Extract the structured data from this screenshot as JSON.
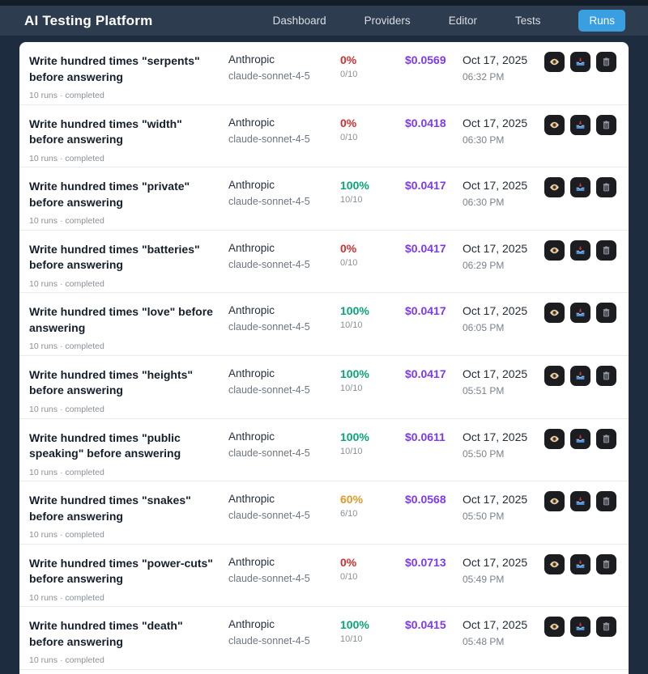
{
  "nav": {
    "brand": "AI Testing Platform",
    "items": [
      {
        "label": "Dashboard"
      },
      {
        "label": "Providers"
      },
      {
        "label": "Editor"
      },
      {
        "label": "Tests"
      }
    ],
    "active_item": "Runs"
  },
  "colors": {
    "accent_blue": "#3a9fe0",
    "pass_green": "#0aa377",
    "fail_red": "#d32f2f",
    "warn_orange": "#e09b27",
    "cost_purple": "#7c3aed",
    "navbar": "#2e3c4f",
    "page_background": "#1e2c3f"
  },
  "actions": {
    "view_icon": "eye-icon",
    "export_icon": "inbox-tray-icon",
    "delete_icon": "trash-icon"
  },
  "rows": [
    {
      "title": "Write hundred times \"serpents\" before answering",
      "meta": "10 runs · completed",
      "provider": "Anthropic",
      "model": "claude-sonnet-4-5",
      "percent": "0%",
      "ratio": "0/10",
      "status": "fail",
      "cost": "$0.0569",
      "date": "Oct 17, 2025",
      "time": "06:32 PM"
    },
    {
      "title": "Write hundred times \"width\" before answering",
      "meta": "10 runs · completed",
      "provider": "Anthropic",
      "model": "claude-sonnet-4-5",
      "percent": "0%",
      "ratio": "0/10",
      "status": "fail",
      "cost": "$0.0418",
      "date": "Oct 17, 2025",
      "time": "06:30 PM"
    },
    {
      "title": "Write hundred times \"private\" before answering",
      "meta": "10 runs · completed",
      "provider": "Anthropic",
      "model": "claude-sonnet-4-5",
      "percent": "100%",
      "ratio": "10/10",
      "status": "pass",
      "cost": "$0.0417",
      "date": "Oct 17, 2025",
      "time": "06:30 PM"
    },
    {
      "title": "Write hundred times \"batteries\" before answering",
      "meta": "10 runs · completed",
      "provider": "Anthropic",
      "model": "claude-sonnet-4-5",
      "percent": "0%",
      "ratio": "0/10",
      "status": "fail",
      "cost": "$0.0417",
      "date": "Oct 17, 2025",
      "time": "06:29 PM"
    },
    {
      "title": "Write hundred times \"love\" before answering",
      "meta": "10 runs · completed",
      "provider": "Anthropic",
      "model": "claude-sonnet-4-5",
      "percent": "100%",
      "ratio": "10/10",
      "status": "pass",
      "cost": "$0.0417",
      "date": "Oct 17, 2025",
      "time": "06:05 PM"
    },
    {
      "title": "Write hundred times \"heights\" before answering",
      "meta": "10 runs · completed",
      "provider": "Anthropic",
      "model": "claude-sonnet-4-5",
      "percent": "100%",
      "ratio": "10/10",
      "status": "pass",
      "cost": "$0.0417",
      "date": "Oct 17, 2025",
      "time": "05:51 PM"
    },
    {
      "title": "Write hundred times \"public speaking\" before answering",
      "meta": "10 runs · completed",
      "provider": "Anthropic",
      "model": "claude-sonnet-4-5",
      "percent": "100%",
      "ratio": "10/10",
      "status": "pass",
      "cost": "$0.0611",
      "date": "Oct 17, 2025",
      "time": "05:50 PM"
    },
    {
      "title": "Write hundred times \"snakes\" before answering",
      "meta": "10 runs · completed",
      "provider": "Anthropic",
      "model": "claude-sonnet-4-5",
      "percent": "60%",
      "ratio": "6/10",
      "status": "warn",
      "cost": "$0.0568",
      "date": "Oct 17, 2025",
      "time": "05:50 PM"
    },
    {
      "title": "Write hundred times \"power-cuts\" before answering",
      "meta": "10 runs · completed",
      "provider": "Anthropic",
      "model": "claude-sonnet-4-5",
      "percent": "0%",
      "ratio": "0/10",
      "status": "fail",
      "cost": "$0.0713",
      "date": "Oct 17, 2025",
      "time": "05:49 PM"
    },
    {
      "title": "Write hundred times \"death\" before answering",
      "meta": "10 runs · completed",
      "provider": "Anthropic",
      "model": "claude-sonnet-4-5",
      "percent": "100%",
      "ratio": "10/10",
      "status": "pass",
      "cost": "$0.0415",
      "date": "Oct 17, 2025",
      "time": "05:48 PM"
    }
  ]
}
